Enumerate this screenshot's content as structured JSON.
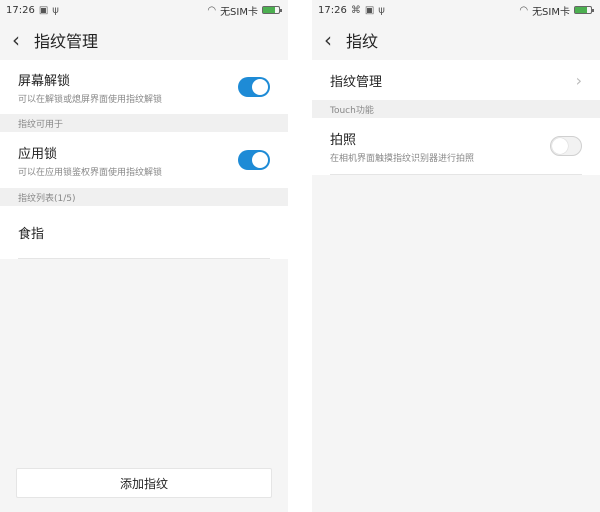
{
  "left": {
    "status": {
      "time": "17:26",
      "carrier": "无SIM卡"
    },
    "title": "指纹管理",
    "screen_lock": {
      "label": "屏幕解锁",
      "desc": "可以在解锁或熄屏界面使用指纹解锁",
      "enabled": true
    },
    "usage_header": "指纹可用于",
    "app_lock": {
      "label": "应用锁",
      "desc": "可以在应用锁鉴权界面使用指纹解锁",
      "enabled": true
    },
    "list_header": "指纹列表(1/5)",
    "fingerprints": [
      {
        "name": "食指"
      }
    ],
    "add_button": "添加指纹"
  },
  "right": {
    "status": {
      "time": "17:26",
      "carrier": "无SIM卡"
    },
    "title": "指纹",
    "manage": {
      "label": "指纹管理"
    },
    "touch_header": "Touch功能",
    "photo": {
      "label": "拍照",
      "desc": "在相机界面触摸指纹识别器进行拍照",
      "enabled": false
    }
  },
  "colors": {
    "accent": "#1e8bd6",
    "background": "#f5f5f5"
  }
}
